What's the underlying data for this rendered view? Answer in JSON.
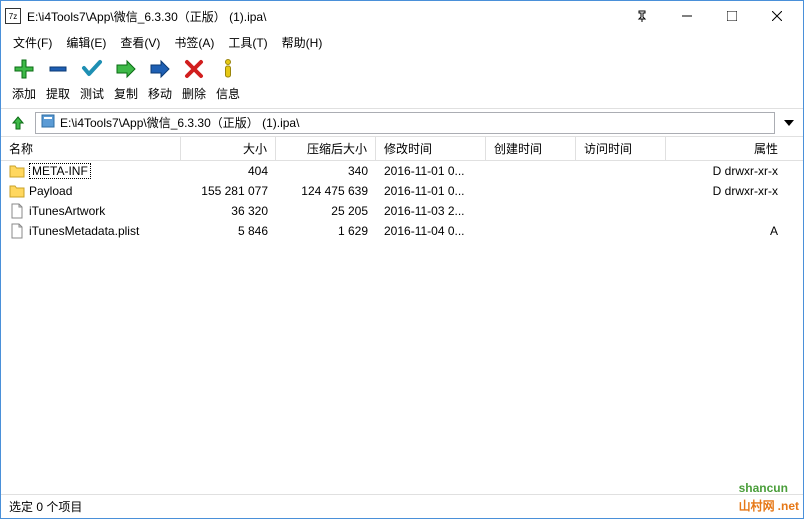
{
  "titlebar": {
    "icon": "7z",
    "title": "E:\\i4Tools7\\App\\微信_6.3.30（正版） (1).ipa\\"
  },
  "menubar": {
    "file": "文件(F)",
    "edit": "编辑(E)",
    "view": "查看(V)",
    "bookmarks": "书签(A)",
    "tools": "工具(T)",
    "help": "帮助(H)"
  },
  "toolbar": {
    "add": "添加",
    "extract": "提取",
    "test": "测试",
    "copy": "复制",
    "move": "移动",
    "delete": "删除",
    "info": "信息"
  },
  "pathbar": {
    "path": "E:\\i4Tools7\\App\\微信_6.3.30（正版） (1).ipa\\"
  },
  "columns": {
    "name": "名称",
    "size": "大小",
    "packed": "压缩后大小",
    "modified": "修改时间",
    "created": "创建时间",
    "accessed": "访问时间",
    "attributes": "属性"
  },
  "files": [
    {
      "name": "META-INF",
      "type": "folder",
      "size": "404",
      "packed": "340",
      "modified": "2016-11-01 0...",
      "created": "",
      "accessed": "",
      "attr": "D drwxr-xr-x",
      "selected": true
    },
    {
      "name": "Payload",
      "type": "folder",
      "size": "155 281 077",
      "packed": "124 475 639",
      "modified": "2016-11-01 0...",
      "created": "",
      "accessed": "",
      "attr": "D drwxr-xr-x",
      "selected": false
    },
    {
      "name": "iTunesArtwork",
      "type": "file",
      "size": "36 320",
      "packed": "25 205",
      "modified": "2016-11-03 2...",
      "created": "",
      "accessed": "",
      "attr": "",
      "selected": false
    },
    {
      "name": "iTunesMetadata.plist",
      "type": "file",
      "size": "5 846",
      "packed": "1 629",
      "modified": "2016-11-04 0...",
      "created": "",
      "accessed": "",
      "attr": "A",
      "selected": false
    }
  ],
  "statusbar": {
    "text": "选定 0 个项目"
  },
  "watermark": {
    "main": "shancun",
    "sub": ".net",
    "tag": "山村网"
  }
}
